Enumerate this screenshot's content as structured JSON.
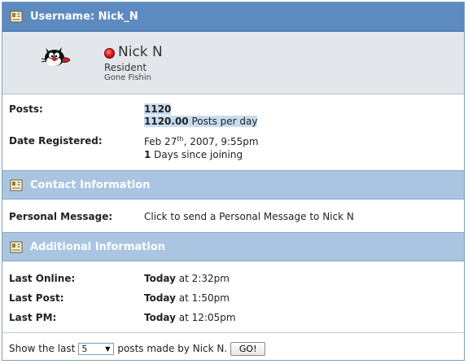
{
  "header": {
    "title": "Username: Nick_N",
    "icon": "profile-card-icon"
  },
  "profile": {
    "display_name": "Nick N",
    "status_color": "#e02020",
    "rank": "Resident",
    "custom_title": "Gone Fishin",
    "avatar_icon": "cartoon-cat-avatar"
  },
  "stats": {
    "posts_label": "Posts:",
    "posts_count": "1120",
    "posts_per_day_value": "1120.00",
    "posts_per_day_text": " Posts per day",
    "registered_label": "Date Registered:",
    "registered_month_day": "Feb 27",
    "registered_suffix": "th",
    "registered_rest": ", 2007, 9:55pm",
    "days_count": "1",
    "days_text": " Days since joining"
  },
  "contact": {
    "title": "Contact Information",
    "pm_label": "Personal Message:",
    "pm_link": "Click to send a Personal Message to Nick N"
  },
  "additional": {
    "title": "Additional Information",
    "rows": [
      {
        "label": "Last Online:",
        "day": "Today",
        "time": " at 2:32pm"
      },
      {
        "label": "Last Post:",
        "day": "Today",
        "time": " at 1:50pm"
      },
      {
        "label": "Last PM:",
        "day": "Today",
        "time": " at 12:05pm"
      }
    ]
  },
  "footer": {
    "prefix": "Show the last",
    "selected_count": "5",
    "suffix": "posts made by Nick N.",
    "go_label": "GO!"
  }
}
